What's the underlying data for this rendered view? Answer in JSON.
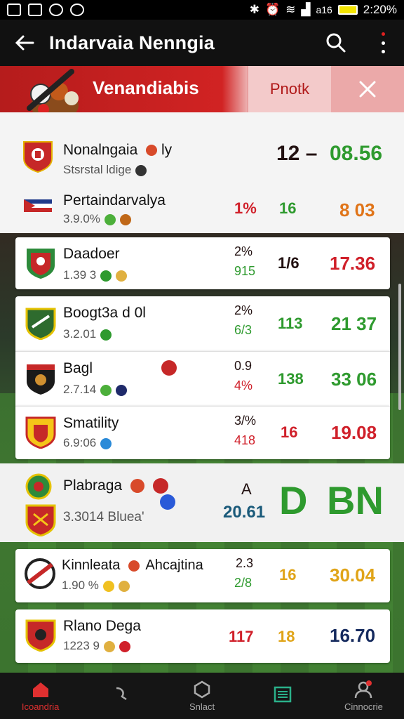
{
  "status": {
    "battery_label": "a16",
    "time": "2:20%"
  },
  "appbar": {
    "title": "Indarvaia Nenngia"
  },
  "banner": {
    "title": "Venandiabis",
    "action": "Pnotk"
  },
  "rows": [
    {
      "name": "Nonalngaia",
      "name_suffix": "ly",
      "sub": "Stsrstal ldige",
      "c1": "",
      "c1b": "",
      "c2": "12 –",
      "c3": "08.56"
    },
    {
      "name": "Pertaindarvalya",
      "sub": "3.9.0%",
      "c1": "1%",
      "c1b": "",
      "c2": "16",
      "c3": "8 03"
    },
    {
      "name": "Daadoer",
      "sub": "1.39 3",
      "c1": "2%",
      "c1b": "915",
      "c2": "1/6",
      "c3": "17.36"
    },
    {
      "name": "Boogt3a d 0l",
      "sub": "3.2.01",
      "c1": "2%",
      "c1b": "6/3",
      "c2": "113",
      "c3": "21 37"
    },
    {
      "name": "Bagl",
      "sub": "2.7.14",
      "c1": "0.9",
      "c1b": "4%",
      "c2": "138",
      "c3": "33 06"
    },
    {
      "name": "Smatility",
      "sub": "6.9:06",
      "c1": "3/%",
      "c1b": "418",
      "c2": "16",
      "c3": "19.08"
    },
    {
      "name": "Plabraga",
      "sub": "3.3014 Bluea'",
      "c1": "A",
      "c1b": "20.61",
      "c2": "D",
      "c3": "BN"
    },
    {
      "name": "Kinnleata",
      "name_suffix": "Ahcajtina",
      "sub": "1.90 %",
      "c1": "2.3",
      "c1b": "2/8",
      "c2": "16",
      "c3": "30.04"
    },
    {
      "name": "Rlano Dega",
      "sub": "1223 9",
      "c1": "",
      "c1b": "117",
      "c2": "18",
      "c3": "16.70"
    }
  ],
  "bottomnav": [
    {
      "label": "Icoandria",
      "icon": "home-icon"
    },
    {
      "label": "",
      "icon": "share-icon"
    },
    {
      "label": "Snlact",
      "icon": "shield-icon"
    },
    {
      "label": "",
      "icon": "list-icon"
    },
    {
      "label": "Cinnocrie",
      "icon": "profile-icon"
    }
  ],
  "colors": {
    "accent": "#d12323",
    "green": "#2e9a2e",
    "navy": "#152a5e"
  }
}
